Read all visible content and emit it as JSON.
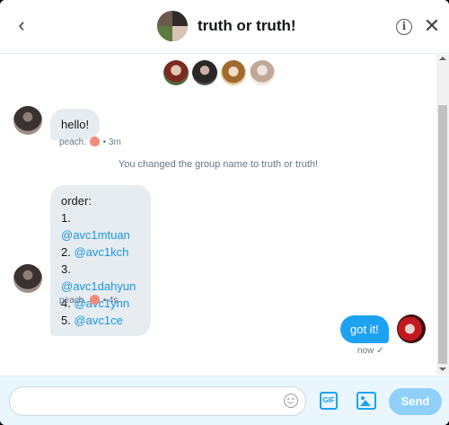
{
  "header": {
    "title": "truth or truth!",
    "back_icon": "chevron-left-icon",
    "info_icon": "info-icon",
    "info_glyph": "i",
    "close_icon": "close-icon"
  },
  "participants": [
    "participant-1",
    "participant-2",
    "participant-3",
    "participant-4"
  ],
  "messages": {
    "m1": {
      "text": "hello!",
      "sender": "peach.",
      "time": "3m"
    },
    "system": "You changed the group name to truth or truth!",
    "m2": {
      "intro": "order:",
      "items": [
        {
          "num": "1.",
          "handle": "@avc1mtuan"
        },
        {
          "num": "2.",
          "handle": "@avc1kch"
        },
        {
          "num": "3.",
          "handle": "@avc1dahyun"
        },
        {
          "num": "4.",
          "handle": "@avc1ynn"
        },
        {
          "num": "5.",
          "handle": "@avc1ce"
        }
      ],
      "sender": "peach.",
      "time": "4s"
    },
    "m3": {
      "text": "got it!",
      "time": "now",
      "status": "✓"
    }
  },
  "composer": {
    "placeholder": "",
    "gif_label": "GIF",
    "send_label": "Send"
  },
  "colors": {
    "accent": "#1da1f2",
    "bubble_in": "#e6ecf0",
    "send_disabled": "#8ed0f9",
    "composer_bg": "#eaf6fe"
  }
}
